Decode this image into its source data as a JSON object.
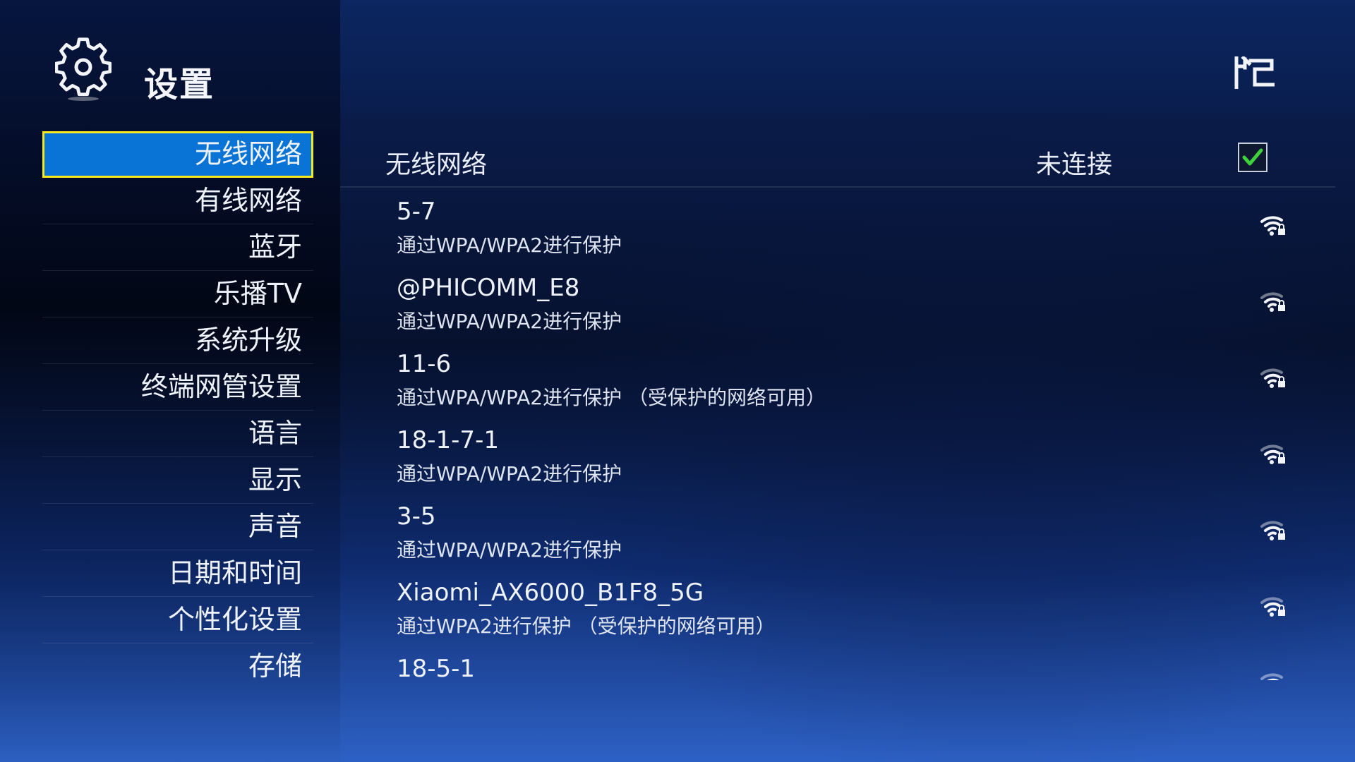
{
  "header": {
    "title": "设置",
    "icon": "gear-icon",
    "logo": "brand-logo-icon"
  },
  "sidebar": {
    "selected_index": 0,
    "items": [
      {
        "label": "无线网络"
      },
      {
        "label": "有线网络"
      },
      {
        "label": "蓝牙"
      },
      {
        "label": "乐播TV"
      },
      {
        "label": "系统升级"
      },
      {
        "label": "终端网管设置"
      },
      {
        "label": "语言"
      },
      {
        "label": "显示"
      },
      {
        "label": "声音"
      },
      {
        "label": "日期和时间"
      },
      {
        "label": "个性化设置"
      },
      {
        "label": "存储"
      }
    ]
  },
  "content": {
    "title": "无线网络",
    "status": "未连接",
    "wifi_enabled": true,
    "networks": [
      {
        "ssid": "5-7",
        "security": "通过WPA/WPA2进行保护",
        "icon": "wifi-lock-icon"
      },
      {
        "ssid": "@PHICOMM_E8",
        "security": "通过WPA/WPA2进行保护",
        "icon": "wifi-lock-icon"
      },
      {
        "ssid": "11-6",
        "security": "通过WPA/WPA2进行保护 （受保护的网络可用）",
        "icon": "wifi-lock-icon"
      },
      {
        "ssid": "18-1-7-1",
        "security": "通过WPA/WPA2进行保护",
        "icon": "wifi-lock-icon"
      },
      {
        "ssid": "3-5",
        "security": "通过WPA/WPA2进行保护",
        "icon": "wifi-lock-icon"
      },
      {
        "ssid": "Xiaomi_AX6000_B1F8_5G",
        "security": "通过WPA2进行保护 （受保护的网络可用）",
        "icon": "wifi-lock-icon"
      },
      {
        "ssid": "18-5-1",
        "security": "",
        "icon": "wifi-lock-icon"
      }
    ]
  },
  "colors": {
    "selection_fill": "#0a73d6",
    "selection_border": "#f5e81e",
    "checkbox_check": "#3fd13a"
  }
}
